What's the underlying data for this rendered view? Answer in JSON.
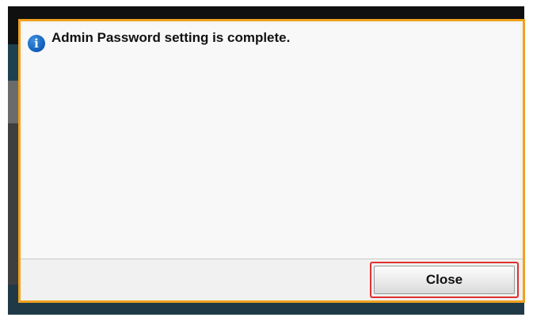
{
  "dialog": {
    "message": "Admin Password setting is complete.",
    "icon": "info-icon",
    "icon_glyph": "i",
    "close_label": "Close"
  },
  "colors": {
    "dialog_border": "#f0a21e",
    "highlight": "#e0302e",
    "info_icon": "#1565c0"
  }
}
